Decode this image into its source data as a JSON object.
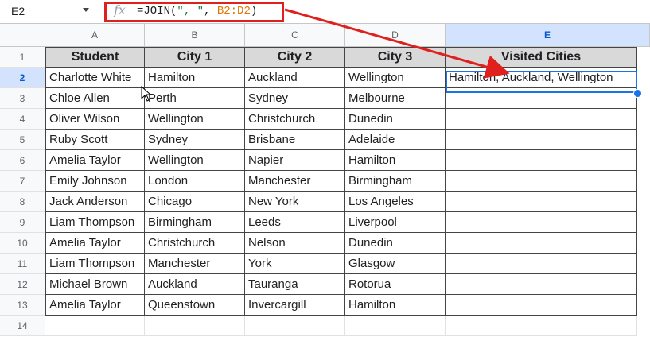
{
  "name_box": {
    "value": "E2"
  },
  "formula_bar": {
    "icon": "fx-icon",
    "prefix": "=JOIN(",
    "arg1": "\", \"",
    "sep": ", ",
    "arg2": "B2:D2",
    "suffix": ")"
  },
  "columns": [
    "A",
    "B",
    "C",
    "D",
    "E"
  ],
  "row_numbers": [
    "1",
    "2",
    "3",
    "4",
    "5",
    "6",
    "7",
    "8",
    "9",
    "10",
    "11",
    "12",
    "13",
    "14"
  ],
  "headers": [
    "Student",
    "City 1",
    "City 2",
    "City 3",
    "Visited Cities"
  ],
  "rows": [
    [
      "Charlotte White",
      "Hamilton",
      "Auckland",
      "Wellington",
      "Hamilton, Auckland, Wellington"
    ],
    [
      "Chloe Allen",
      "Perth",
      "Sydney",
      "Melbourne",
      ""
    ],
    [
      "Oliver Wilson",
      "Wellington",
      "Christchurch",
      "Dunedin",
      ""
    ],
    [
      "Ruby Scott",
      "Sydney",
      "Brisbane",
      "Adelaide",
      ""
    ],
    [
      "Amelia Taylor",
      "Wellington",
      "Napier",
      "Hamilton",
      ""
    ],
    [
      "Emily Johnson",
      "London",
      "Manchester",
      "Birmingham",
      ""
    ],
    [
      "Jack Anderson",
      "Chicago",
      "New York",
      "Los Angeles",
      ""
    ],
    [
      "Liam Thompson",
      "Birmingham",
      "Leeds",
      "Liverpool",
      ""
    ],
    [
      "Amelia Taylor",
      "Christchurch",
      "Nelson",
      "Dunedin",
      ""
    ],
    [
      "Liam Thompson",
      "Manchester",
      "York",
      "Glasgow",
      ""
    ],
    [
      "Michael Brown",
      "Auckland",
      "Tauranga",
      "Rotorua",
      ""
    ],
    [
      "Amelia Taylor",
      "Queenstown",
      "Invercargill",
      "Hamilton",
      ""
    ]
  ],
  "selected_cell": "E2",
  "colors": {
    "highlight": "#e0201c",
    "selection": "#1a73e8",
    "header_fill": "#d9d9d9"
  }
}
